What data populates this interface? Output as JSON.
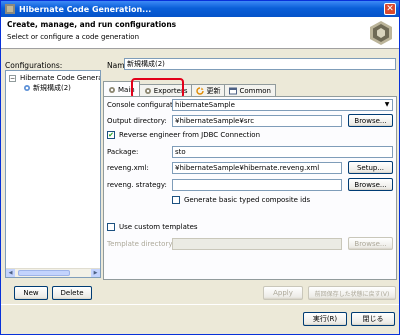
{
  "window": {
    "title": "Hibernate Code Generation...",
    "close_glyph": "✕"
  },
  "header": {
    "title": "Create, manage, and run configurations",
    "subtitle": "Select or configure a code generation"
  },
  "left": {
    "label": "Configurations:",
    "tree": [
      {
        "label": "Hibernate Code Generation",
        "toggle": "−",
        "icon": "hibernate-icon"
      },
      {
        "label": "新規構成(2)",
        "icon": "config-icon"
      }
    ],
    "new_label": "New",
    "delete_label": "Delete"
  },
  "name": {
    "label": "Name:",
    "value": "新規構成(2)"
  },
  "tabs": [
    {
      "label": "Main",
      "icon": "main-tab-icon"
    },
    {
      "label": "Exporters",
      "icon": "exporters-tab-icon"
    },
    {
      "label": "更新",
      "icon": "refresh-tab-icon"
    },
    {
      "label": "Common",
      "icon": "common-tab-icon"
    }
  ],
  "main": {
    "console_label": "Console configuration:",
    "console_value": "hibernateSample",
    "output_label": "Output directory:",
    "output_value": "¥hibernateSample¥src",
    "browse_label": "Browse...",
    "reverse_label": "Reverse engineer from JDBC Connection",
    "package_label": "Package:",
    "package_value": "sto",
    "revengxml_label": "reveng.xml:",
    "revengxml_value": "¥hibernateSample¥hibernate.reveng.xml",
    "setup_label": "Setup...",
    "strategy_label": "reveng. strategy:",
    "strategy_value": "",
    "composite_label": "Generate basic typed composite ids",
    "custom_templates_label": "Use custom templates",
    "template_dir_label": "Template directory:"
  },
  "footer": {
    "apply_label": "Apply",
    "revert_label": "前回保存した状態に戻す(V)",
    "run_label": "実行(R)",
    "close_label": "閉じる"
  }
}
